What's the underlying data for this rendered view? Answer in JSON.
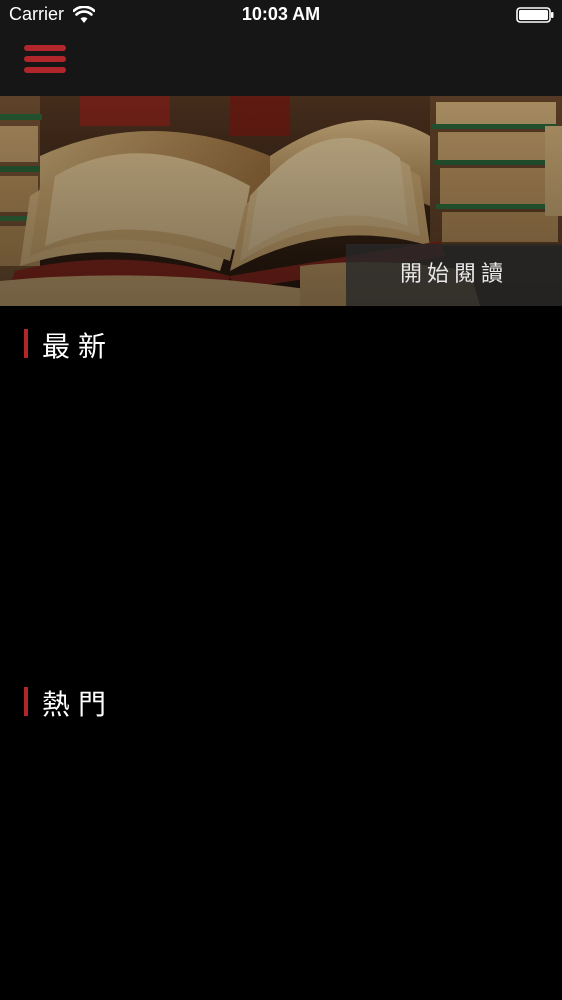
{
  "status_bar": {
    "carrier": "Carrier",
    "time": "10:03 AM"
  },
  "nav": {
    "menu_icon": "hamburger-menu-icon",
    "accent_color": "#b1262b"
  },
  "banner": {
    "image": "open-books-photo",
    "button_label": "開始閱讀"
  },
  "sections": {
    "latest_title": "最新",
    "popular_title": "熱門"
  }
}
